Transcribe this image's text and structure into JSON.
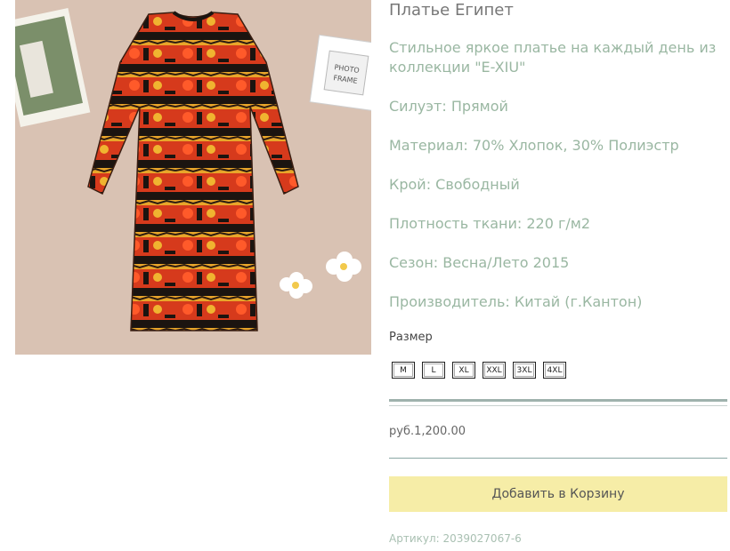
{
  "product": {
    "image_alt": "dress-photo",
    "frame_text": [
      "PHOTO",
      "FRAME"
    ],
    "title": "Платье Египет",
    "description": "Стильное яркое платье на каждый день из коллекции \"E-XIU\"",
    "attributes": [
      "Силуэт: Прямой",
      "Материал: 70% Хлопок, 30% Полиэстр",
      "Крой: Свободный",
      "Плотность ткани: 220 г/м2",
      "Сезон: Весна/Лето 2015",
      "Производитель: Китай (г.Кантон)"
    ],
    "size_label": "Размер",
    "sizes": [
      "M",
      "L",
      "XL",
      "XXL",
      "3XL",
      "4XL"
    ],
    "price": "руб.1,200.00",
    "add_to_cart_label": "Добавить в Корзину",
    "sku": "Артикул: 2039027067-6"
  },
  "colors": {
    "description_text": "#9ab7a2",
    "cart_button_bg": "#f6eda7",
    "divider": "#9fb2ad"
  }
}
